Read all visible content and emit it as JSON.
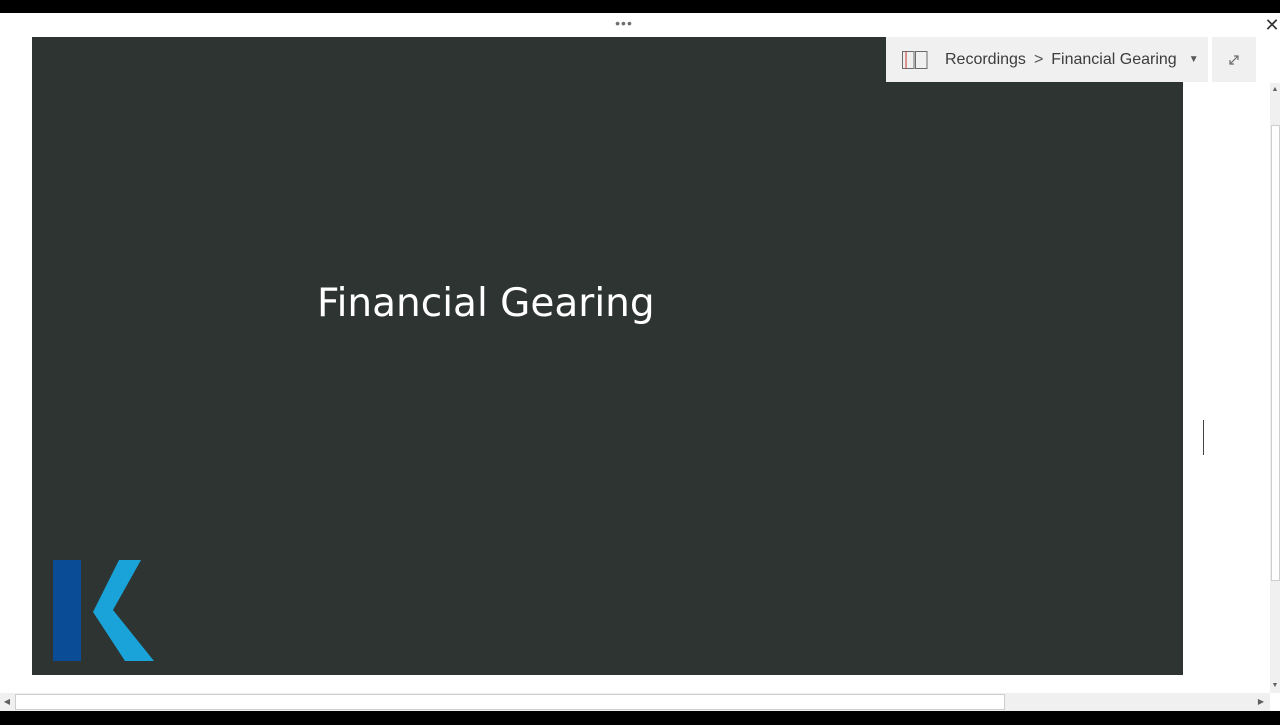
{
  "window": {
    "drag_handle": "•••",
    "close_glyph": "✕"
  },
  "slide": {
    "title": "Financial Gearing",
    "background_color": "#2d3432",
    "logo": {
      "icon": "k-logo-icon",
      "dark_blue": "#0a4d96",
      "light_blue": "#1aa3d9"
    }
  },
  "navigation": {
    "icon": "notebook-icon",
    "breadcrumb": [
      "Recordings",
      "Financial Gearing"
    ],
    "separator": ">",
    "dropdown_glyph": "▼",
    "expand_icon": "expand-icon"
  },
  "scrollbars": {
    "up_glyph": "▲",
    "down_glyph": "▼",
    "left_glyph": "◀",
    "right_glyph": "▶"
  }
}
